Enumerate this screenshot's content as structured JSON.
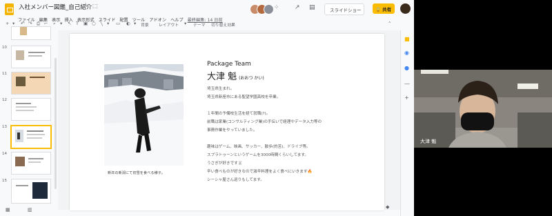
{
  "app": {
    "title": "入社メンバー図鑑_自己紹介",
    "menu": [
      "ファイル",
      "編集",
      "表示",
      "挿入",
      "表示形式",
      "スライド",
      "配置",
      "ツール",
      "アドオン",
      "ヘルプ"
    ],
    "last_edit": "最終編集: 14 日前"
  },
  "header": {
    "present_label": "スライドショー",
    "share_label": "共有"
  },
  "toolbar": {
    "background": "背景",
    "layout": "レイアウト",
    "theme": "テーマ",
    "transition": "切り替え効果"
  },
  "filmstrip": {
    "slide_numbers": [
      "9",
      "10",
      "11",
      "12",
      "13",
      "14",
      "15"
    ],
    "selected": "13"
  },
  "slide": {
    "team": "Package Team",
    "name": "大津 魁",
    "name_reading": "(おおつ かい)",
    "caption": "新年の新潟にて初雪を食べる様子。",
    "bio": [
      "埼玉県生まれ。",
      "埼玉県新座市にある聖望学園高校を卒業。",
      "",
      "１年間の予備校生活を経て就職(?)。",
      "前職は家業(コンサルティング業)の手伝いで経理やデータ入力等の",
      "事務作業をやっていました。",
      "",
      "趣味はゲーム、映画、サッカー、散歩(的苦)、ドライブ等。",
      "スプラトゥーンというゲームを3000時間くらいしてます。",
      "うさぎが好きです🐰",
      "辛い食べものが好きなので激辛料理をよく食べにいきます🔥",
      "シーシャ屋さん巡りもしてます。"
    ]
  },
  "webcam": {
    "participant_name": "大津 魁"
  },
  "colors": {
    "accent": "#fbbc04",
    "slides_brand": "#f4b400"
  }
}
